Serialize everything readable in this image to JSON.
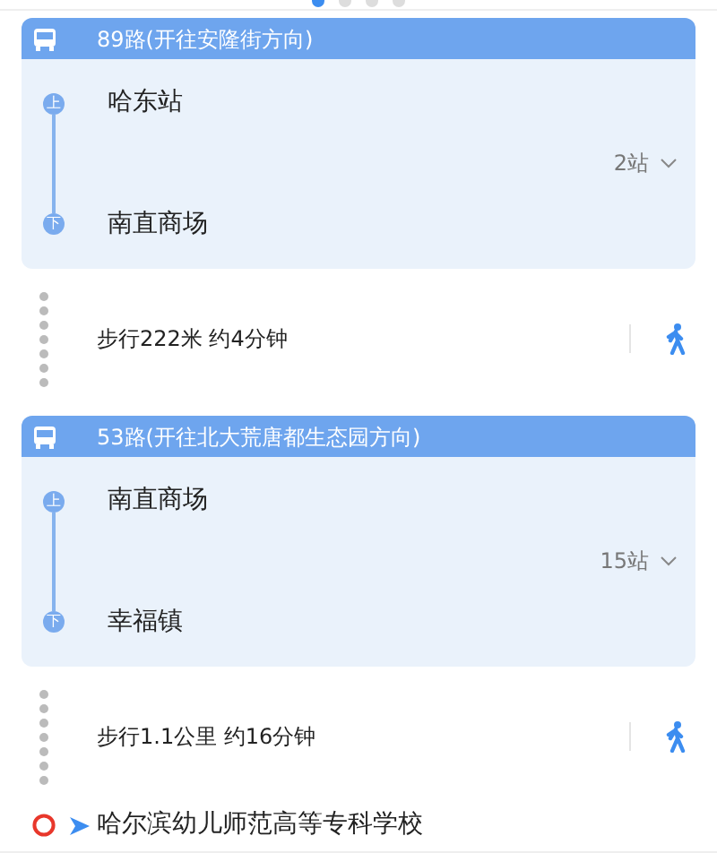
{
  "page_dots": [
    {
      "selected": true
    },
    {
      "selected": false
    },
    {
      "selected": false
    },
    {
      "selected": false
    }
  ],
  "segments": [
    {
      "kind": "bus",
      "line": "89路(开往安隆街方向)",
      "board_tag": "上",
      "board": "哈东站",
      "stop_count": "2站",
      "alight_tag": "下",
      "alight": "南直商场"
    },
    {
      "kind": "walk",
      "text": "步行222米 约4分钟"
    },
    {
      "kind": "bus",
      "line": "53路(开往北大荒唐都生态园方向)",
      "board_tag": "上",
      "board": "南直商场",
      "stop_count": "15站",
      "alight_tag": "下",
      "alight": "幸福镇"
    },
    {
      "kind": "walk",
      "text": "步行1.1公里 约16分钟"
    }
  ],
  "destination": {
    "name": "哈尔滨幼儿师范高等专科学校"
  }
}
